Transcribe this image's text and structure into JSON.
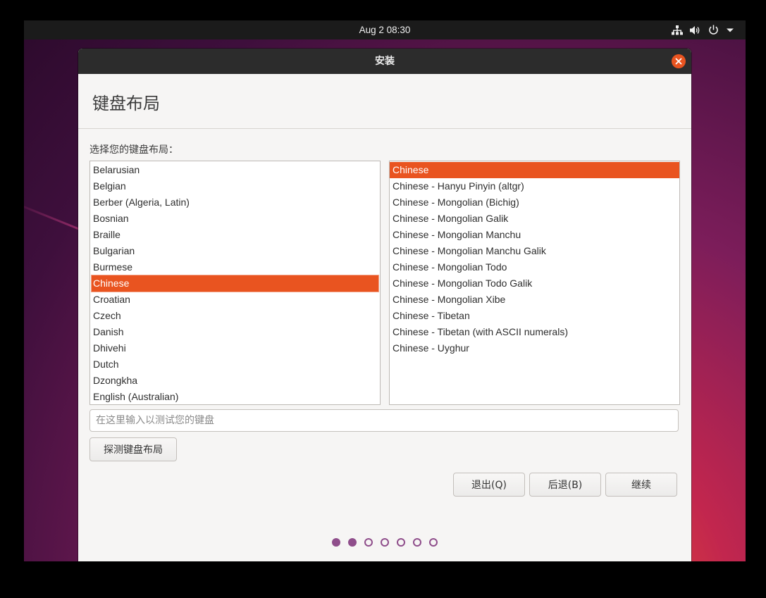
{
  "topbar": {
    "clock": "Aug 2  08:30",
    "icons": [
      "network-icon",
      "volume-icon",
      "power-icon",
      "chevron-down-icon"
    ]
  },
  "window": {
    "title": "安装",
    "page_title": "键盘布局",
    "prompt": "选择您的键盘布局："
  },
  "layouts": {
    "items": [
      "Belarusian",
      "Belgian",
      "Berber (Algeria, Latin)",
      "Bosnian",
      "Braille",
      "Bulgarian",
      "Burmese",
      "Chinese",
      "Croatian",
      "Czech",
      "Danish",
      "Dhivehi",
      "Dutch",
      "Dzongkha",
      "English (Australian)"
    ],
    "selected": "Chinese"
  },
  "variants": {
    "items": [
      "Chinese",
      "Chinese - Hanyu Pinyin (altgr)",
      "Chinese - Mongolian (Bichig)",
      "Chinese - Mongolian Galik",
      "Chinese - Mongolian Manchu",
      "Chinese - Mongolian Manchu Galik",
      "Chinese - Mongolian Todo",
      "Chinese - Mongolian Todo Galik",
      "Chinese - Mongolian Xibe",
      "Chinese - Tibetan",
      "Chinese - Tibetan (with ASCII numerals)",
      "Chinese - Uyghur"
    ],
    "selected": "Chinese"
  },
  "test_input": {
    "value": "",
    "placeholder": "在这里输入以测试您的键盘"
  },
  "buttons": {
    "detect": "探测键盘布局",
    "quit": "退出(Q)",
    "back": "后退(B)",
    "continue": "继续"
  },
  "progress": {
    "total_steps": 7,
    "completed_steps": 2
  },
  "colors": {
    "accent": "#e95420",
    "progress_dot": "#8f4e8b",
    "titlebar": "#2c2c2c"
  }
}
